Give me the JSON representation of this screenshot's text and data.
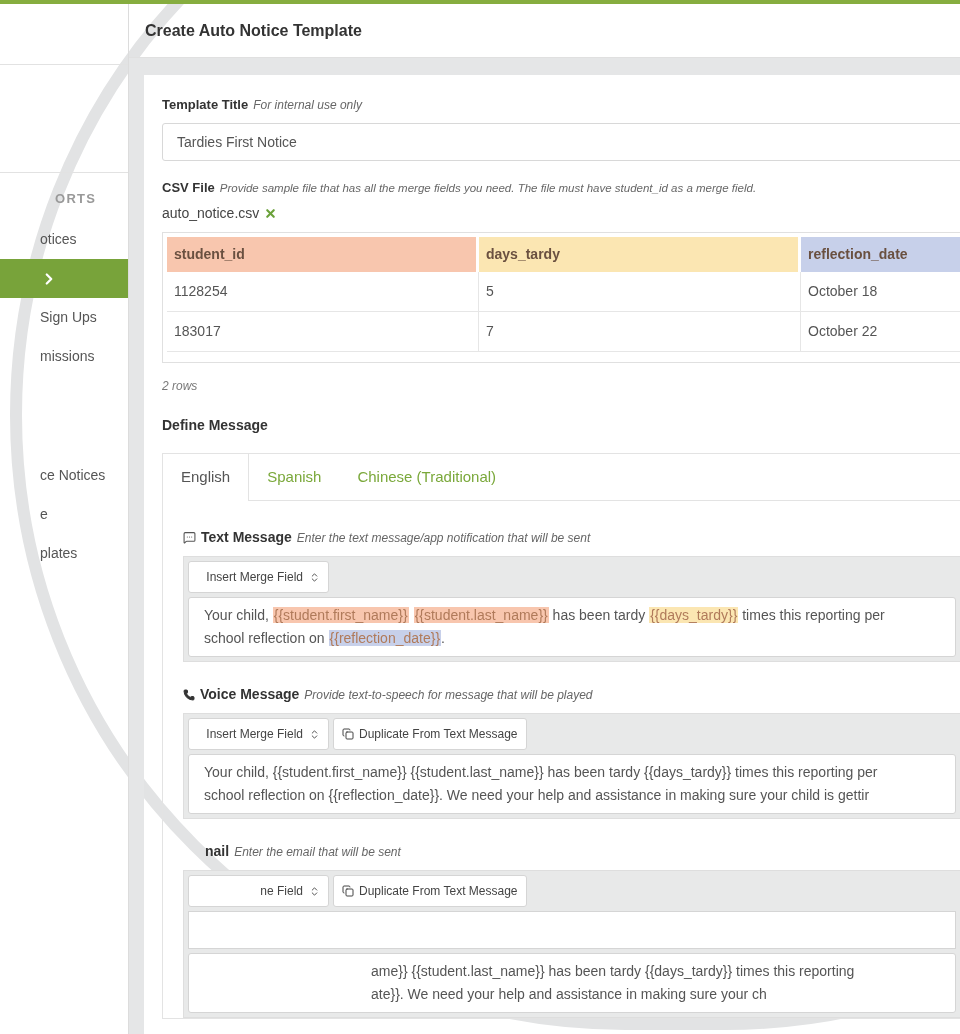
{
  "sidebar": {
    "items": [
      {
        "kind": "header",
        "label": "ORTS"
      },
      {
        "kind": "link",
        "label": "otices",
        "selected": false
      },
      {
        "kind": "link",
        "selected": true
      },
      {
        "kind": "link",
        "label": "Sign Ups",
        "selected": false
      },
      {
        "kind": "link",
        "label": "missions",
        "selected": false
      },
      {
        "kind": "gap"
      },
      {
        "kind": "link",
        "label": "ce Notices",
        "selected": false
      },
      {
        "kind": "link",
        "label": "e",
        "selected": false
      },
      {
        "kind": "link",
        "label": "plates",
        "selected": false
      }
    ]
  },
  "page": {
    "title": "Create Auto Notice Template"
  },
  "template_title": {
    "label": "Template Title",
    "hint": "For internal use only",
    "value": "Tardies First Notice"
  },
  "csv_file": {
    "label": "CSV File",
    "hint": "Provide sample file that has all the merge fields you need. The file must have student_id as a merge field.",
    "file_name": "auto_notice.csv"
  },
  "table": {
    "columns": [
      {
        "label": "student_id",
        "color": "#f8c6ae"
      },
      {
        "label": "days_tardy",
        "color": "#fbe6b2"
      },
      {
        "label": "reflection_date",
        "color": "#c7d0ea"
      }
    ],
    "rows": [
      [
        "1128254",
        "5",
        "October 18"
      ],
      [
        "183017",
        "7",
        "October 22"
      ]
    ],
    "count": "2 rows"
  },
  "define_message": {
    "label": "Define Message",
    "tabs": [
      {
        "label": "English",
        "selected": true
      },
      {
        "label": "Spanish",
        "selected": false
      },
      {
        "label": "Chinese (Traditional)",
        "selected": false
      }
    ],
    "sections": [
      {
        "kind": "text",
        "title": "Text Message",
        "hint": "Enter the text message/app notification that will be sent",
        "select": "Insert Merge Field",
        "lines": [
          [
            {
              "text": "Your child, "
            },
            {
              "text": "{{student.first_name}}",
              "color": "#f8c6ae"
            },
            {
              "text": "{{student.last_name}}",
              "color": "#f8c6ae"
            },
            {
              "text": " has been tardy "
            },
            {
              "text": "{{days_tardy}}",
              "color": "#fbe6b2"
            },
            {
              "text": " times this reporting per"
            }
          ],
          [
            {
              "text": "school reflection on "
            },
            {
              "text": "{{reflection_date}}",
              "color": "#c7d0ea"
            },
            {
              "text": "."
            }
          ]
        ]
      },
      {
        "kind": "voice",
        "title": "Voice Message",
        "hint": "Provide text-to-speech for message that will be played",
        "select": "Insert Merge Field",
        "button": "Duplicate From Text Message",
        "lines": [
          [
            {
              "text": "Your child, {{student.first_name}} {{student.last_name}} has been tardy {{days_tardy}} times this reporting per"
            }
          ],
          [
            {
              "text": "school reflection on {{reflection_date}}. We need your help and assistance in making sure your child is gettir"
            }
          ]
        ]
      },
      {
        "kind": "email",
        "title": "nail",
        "hint": "Enter the email that will be sent",
        "select": "ne Field",
        "button": "Duplicate From Text Message",
        "lines": [
          [
            {
              "text": "ame}} {{student.last_name}} has been tardy {{days_tardy}} times this reporting"
            }
          ],
          [
            {
              "text": "ate}}. We need your help and assistance in making sure your ch"
            }
          ]
        ]
      }
    ]
  }
}
